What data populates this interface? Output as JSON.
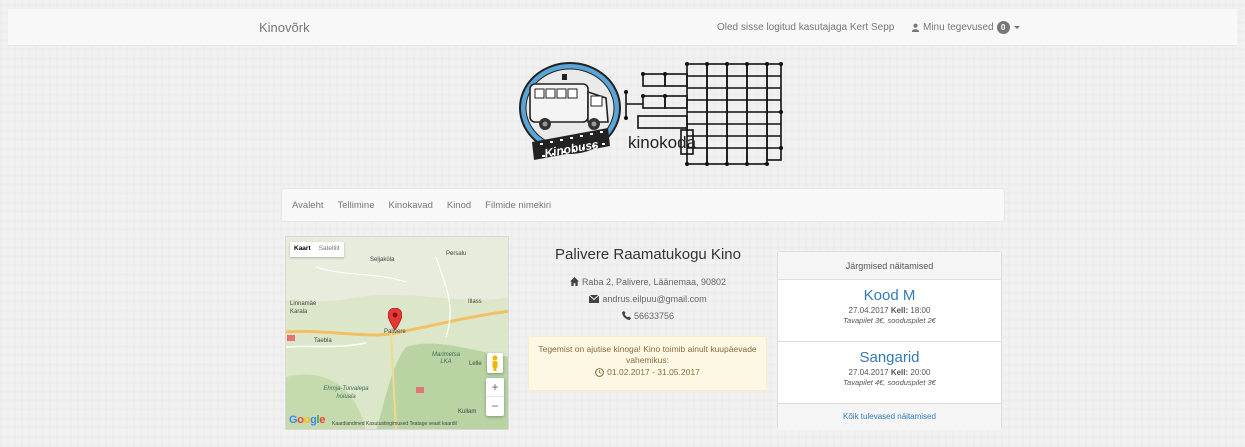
{
  "navbar": {
    "brand": "Kinovõrk",
    "logged_in_text": "Oled sisse logitud kasutajaga Kert Sepp",
    "my_activities": "Minu tegevused",
    "badge_count": "0"
  },
  "logo": {
    "left_text": "Kinobuss",
    "right_text": "kinokoda"
  },
  "menu": [
    {
      "label": "Avaleht"
    },
    {
      "label": "Tellimine"
    },
    {
      "label": "Kinokavad"
    },
    {
      "label": "Kinod"
    },
    {
      "label": "Filmide nimekiri"
    }
  ],
  "map": {
    "toggle_map": "Kaart",
    "toggle_satellite": "Satelliit",
    "zoom_in": "+",
    "zoom_out": "−",
    "google": "Google",
    "footer": "Kaardiandmed   Kasutustingimused   Teatage veast kaardil",
    "labels": {
      "selja": "Seljaküla",
      "persa": "Persalu",
      "linnamae": "Linnamäe",
      "karla": "Karala",
      "iiass": "Illass",
      "palivere": "Palivere",
      "taebla": "Taebla",
      "marimetsa": "Marimetsa LKA",
      "lelle": "Lelle",
      "ehmja": "Ehmja-Turvalepa hoiuala",
      "kullam": "Kullam"
    }
  },
  "cinema": {
    "name": "Palivere Raamatukogu Kino",
    "address": "Raba 2, Palivere, Läänemaa, 90802",
    "email": "andrus.eilpuu@gmail.com",
    "phone": "56633756",
    "notice_text": "Tegemist on ajutise kinoga! Kino toimib ainult kuupäevade vahemikus:",
    "notice_dates": "01.02.2017 - 31.05.2017"
  },
  "upcoming": {
    "header": "Järgmised näitamised",
    "shows": [
      {
        "title": "Kood M",
        "date": "27.04.2017",
        "time_label": "Kell:",
        "time": "18:00",
        "price": "Tavapilet 3€, sooduspilet 2€"
      },
      {
        "title": "Sangarid",
        "date": "27.04.2017",
        "time_label": "Kell:",
        "time": "20:00",
        "price": "Tavapilet 4€, sooduspilet 3€"
      }
    ],
    "all_link": "Kõik tulevased näitamised"
  },
  "colors": {
    "link": "#337ab7",
    "marker": "#e53935",
    "notice_bg": "#fcf8e3"
  }
}
